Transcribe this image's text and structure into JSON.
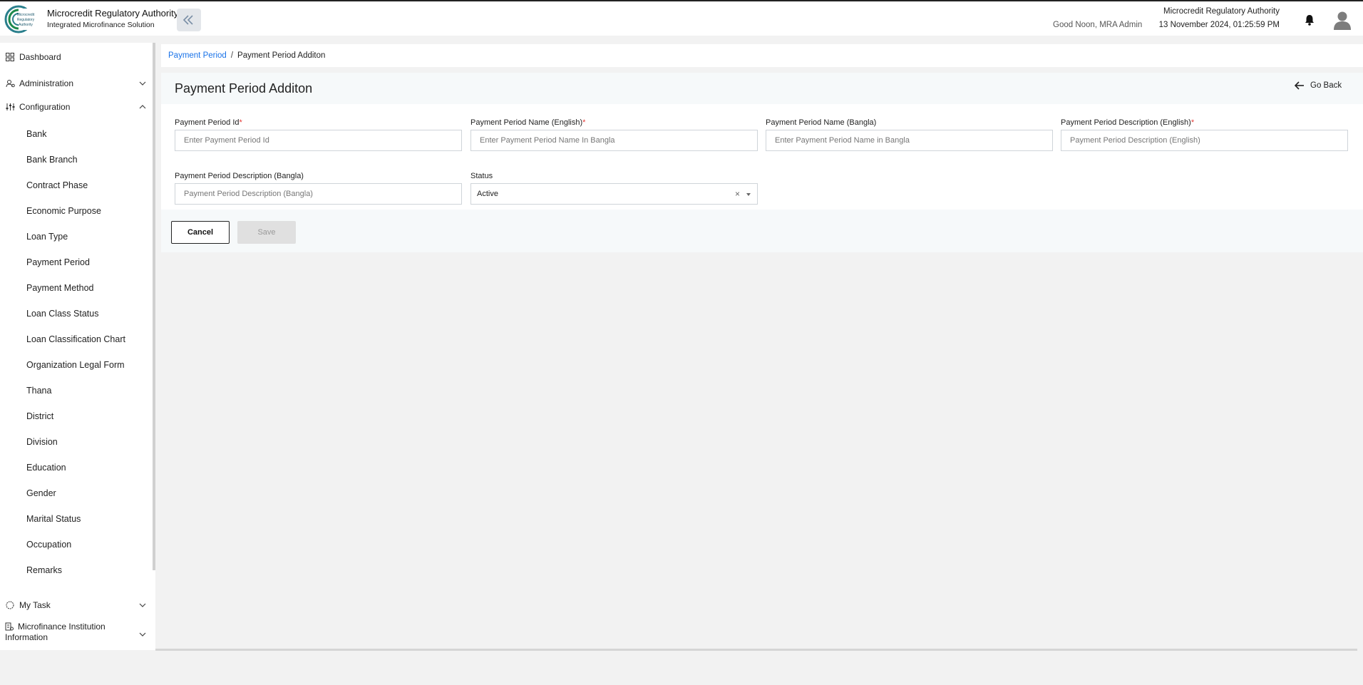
{
  "header": {
    "brand_title": "Microcredit Regulatory Authority",
    "brand_subtitle": "Integrated Microfinance Solution",
    "logo_text": "Microcredit Regulatory Authority",
    "greeting": "Good Noon, MRA Admin",
    "org_name": "Microcredit Regulatory Authority",
    "datetime": "13 November 2024, 01:25:59 PM",
    "icons": {
      "collapse": "double-chevron-left-icon",
      "notifications": "bell-icon",
      "profile": "user-avatar-icon"
    }
  },
  "sidebar": {
    "dashboard": "Dashboard",
    "administration": "Administration",
    "configuration": "Configuration",
    "configuration_items": [
      "Bank",
      "Bank Branch",
      "Contract Phase",
      "Economic Purpose",
      "Loan Type",
      "Payment Period",
      "Payment Method",
      "Loan Class Status",
      "Loan Classification Chart",
      "Organization Legal Form",
      "Thana",
      "District",
      "Division",
      "Education",
      "Gender",
      "Marital Status",
      "Occupation",
      "Remarks"
    ],
    "my_task": "My Task",
    "mfi_info": "Microfinance Institution Information"
  },
  "breadcrumb": {
    "parent": "Payment Period",
    "separator": "/",
    "current": "Payment Period Additon"
  },
  "page": {
    "title": "Payment Period Additon",
    "go_back": "Go Back"
  },
  "form": {
    "id_label": "Payment Period Id",
    "id_placeholder": "Enter Payment Period Id",
    "name_en_label": "Payment Period Name (English)",
    "name_en_placeholder": "Enter Payment Period Name In Bangla",
    "name_bn_label": "Payment Period Name (Bangla)",
    "name_bn_placeholder": "Enter Payment Period Name in Bangla",
    "desc_en_label": "Payment Period Description (English)",
    "desc_en_placeholder": "Payment Period Description (English)",
    "desc_bn_label": "Payment Period Description (Bangla)",
    "desc_bn_placeholder": "Payment Period Description (Bangla)",
    "status_label": "Status",
    "status_value": "Active",
    "status_clear": "×",
    "required_mark": "*"
  },
  "actions": {
    "cancel": "Cancel",
    "save": "Save"
  },
  "colors": {
    "link": "#1a73e8",
    "required": "#e53935",
    "logo_green": "#1e8a4c",
    "logo_teal": "#2a7f8c"
  }
}
